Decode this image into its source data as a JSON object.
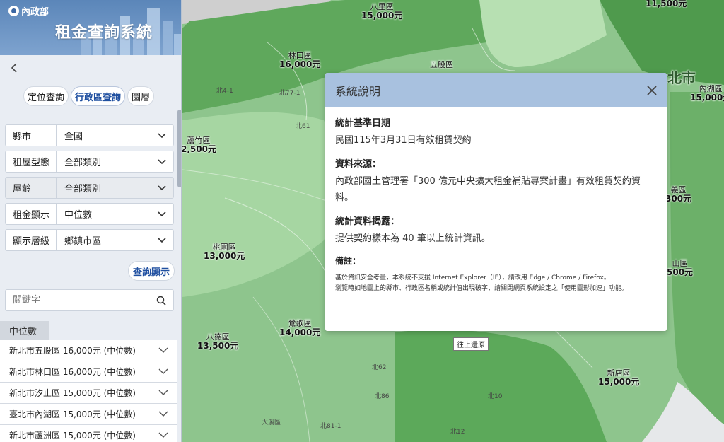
{
  "app": {
    "logo_text": "內政部",
    "title": "租金查詢系統"
  },
  "sidebar": {
    "back_icon": "chevron-left-icon",
    "tabs": [
      {
        "label": "定位查詢"
      },
      {
        "label": "行政區查詢"
      },
      {
        "label": "圖層"
      }
    ],
    "filters": [
      {
        "label": "縣市",
        "value": "全國"
      },
      {
        "label": "租屋型態",
        "value": "全部類別"
      },
      {
        "label": "屋齡",
        "value": "全部類別"
      },
      {
        "label": "租金顯示",
        "value": "中位數"
      },
      {
        "label": "顯示層級",
        "value": "鄉鎮市區"
      }
    ],
    "query_button": "查詢顯示",
    "search_placeholder": "關鍵字",
    "results_header": "中位數",
    "results": [
      {
        "text": "新北市五股區 16,000元 (中位數)"
      },
      {
        "text": "新北市林口區 16,000元 (中位數)"
      },
      {
        "text": "新北市汐止區 15,000元 (中位數)"
      },
      {
        "text": "臺北市內湖區 15,000元 (中位數)"
      },
      {
        "text": "新北市蘆洲區 15,000元 (中位數)"
      }
    ]
  },
  "map": {
    "districts": [
      {
        "name": "八里區",
        "price": "15,000元"
      },
      {
        "name": "",
        "price": "11,500元"
      },
      {
        "name": "林口區",
        "price": "16,000元"
      },
      {
        "name": "五股區",
        "price": ""
      },
      {
        "name": "內湖區",
        "price": "15,000元"
      },
      {
        "name": "蘆竹區",
        "price": "2,500元"
      },
      {
        "name": "桃園區",
        "price": "13,000元"
      },
      {
        "name": "鶯歌區",
        "price": "14,000元"
      },
      {
        "name": "八德區",
        "price": "13,500元"
      },
      {
        "name": "新店區",
        "price": "15,000元"
      },
      {
        "name": "義區",
        "price": "300元"
      },
      {
        "name": "山區",
        "price": "500元"
      }
    ],
    "city_label": "北市",
    "nav_tag": "往上還原",
    "road_labels": [
      "北77-1",
      "北4-1",
      "北61",
      "北81-1",
      "北12",
      "北86",
      "北10",
      "北62",
      "大溪區"
    ]
  },
  "modal": {
    "title": "系統說明",
    "sections": [
      {
        "title": "統計基準日期",
        "text": "民國115年3月31日有效租賃契約"
      },
      {
        "title": "資料來源：",
        "text": "內政部國土管理署「300 億元中央擴大租金補貼專案計畫」有效租賃契約資料。"
      },
      {
        "title": "統計資料揭露：",
        "text": "提供契約樣本為 40 筆以上統計資訊。"
      }
    ],
    "note_title": "備註：",
    "note_lines": [
      "基於資訊安全考量，本系統不支援 Internet Explorer（IE），請改用 Edge / Chrome / Firefox。",
      "瀏覽時如地圖上的縣市、行政區名稱或統計值出現破字，請關閉網頁系統設定之「使用圖形加速」功能。"
    ]
  }
}
